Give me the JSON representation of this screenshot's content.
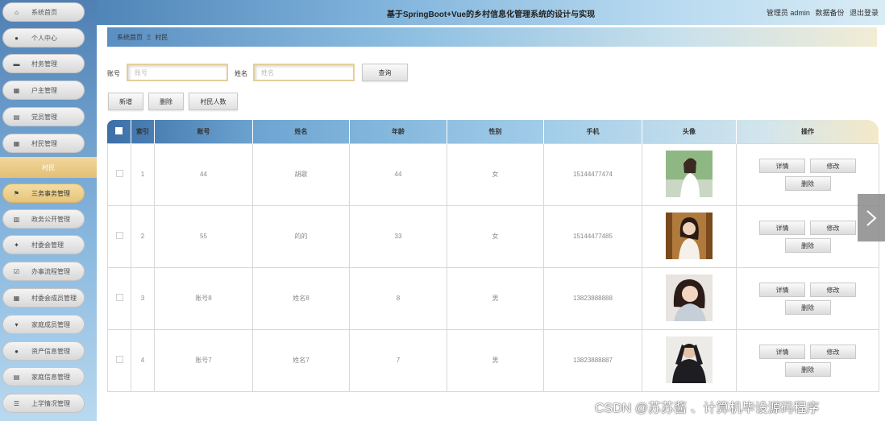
{
  "header": {
    "title": "基于SpringBoot+Vue的乡村信息化管理系统的设计与实现",
    "user": "管理员 admin",
    "backup": "数据备份",
    "logout": "退出登录"
  },
  "sidebar": {
    "items": [
      {
        "label": "系统首页",
        "icon": "home-icon"
      },
      {
        "label": "个人中心",
        "icon": "user-icon"
      },
      {
        "label": "村务管理",
        "icon": "list-icon"
      },
      {
        "label": "户主管理",
        "icon": "grid-icon"
      },
      {
        "label": "党员管理",
        "icon": "doc-icon"
      },
      {
        "label": "村民管理",
        "icon": "grid-icon"
      },
      {
        "label": "三务事务管理",
        "icon": "flag-icon"
      },
      {
        "label": "政务公开管理",
        "icon": "bank-icon"
      },
      {
        "label": "村委会管理",
        "icon": "thumb-icon"
      },
      {
        "label": "办事流程管理",
        "icon": "check-icon"
      },
      {
        "label": "村委会成员管理",
        "icon": "grid-icon"
      },
      {
        "label": "家庭成员管理",
        "icon": "tag-icon"
      },
      {
        "label": "资产信息管理",
        "icon": "pin-icon"
      },
      {
        "label": "家庭信息管理",
        "icon": "doc-icon"
      },
      {
        "label": "上学情况管理",
        "icon": "menu-icon"
      }
    ],
    "sub_item": "村民"
  },
  "breadcrumb": {
    "home": "系统首页",
    "separator": "Ξ",
    "current": "村民"
  },
  "search": {
    "account_label": "账号",
    "account_placeholder": "账号",
    "name_label": "姓名",
    "name_placeholder": "姓名",
    "query_button": "查询"
  },
  "toolbar": {
    "add": "新增",
    "delete": "删除",
    "count": "村民人数"
  },
  "table": {
    "headers": [
      "索引",
      "账号",
      "姓名",
      "年龄",
      "性别",
      "手机",
      "头像",
      "操作"
    ],
    "rows": [
      {
        "index": "1",
        "account": "44",
        "name": "胡歌",
        "age": "44",
        "gender": "女",
        "phone": "15144477474"
      },
      {
        "index": "2",
        "account": "55",
        "name": "的的",
        "age": "33",
        "gender": "女",
        "phone": "15144477485"
      },
      {
        "index": "3",
        "account": "账号8",
        "name": "姓名8",
        "age": "8",
        "gender": "男",
        "phone": "13823888888"
      },
      {
        "index": "4",
        "account": "账号7",
        "name": "姓名7",
        "age": "7",
        "gender": "男",
        "phone": "13823888887"
      }
    ],
    "actions": {
      "detail": "详情",
      "edit": "修改",
      "delete": "删除"
    }
  },
  "watermark": "CSDN @苏苏酱 、计算机毕设源码程序",
  "colors": {
    "accent_gold": "#e7c47a",
    "header_blue": "#4f85b8"
  }
}
